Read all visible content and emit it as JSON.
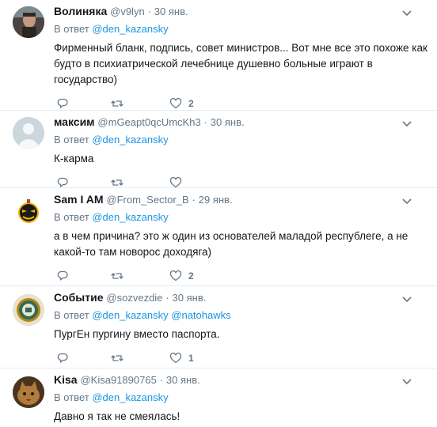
{
  "tweets": [
    {
      "name": "Волиняка",
      "handle": "@v9lyn",
      "dot": "·",
      "time": "30 янв.",
      "reply_prefix": "В ответ",
      "reply_links": [
        "@den_kazansky"
      ],
      "text": "Фирменный бланк, подпись, совет министров... Вот мне все это похоже как будто в психиатрической лечебнице душевно больные играют в государство)",
      "like_count": "2",
      "avatar": "photo-man-icon"
    },
    {
      "name": "максим",
      "handle": "@mGeapt0qcUmcKh3",
      "dot": "·",
      "time": "30 янв.",
      "reply_prefix": "В ответ",
      "reply_links": [
        "@den_kazansky"
      ],
      "text": "К-карма",
      "like_count": "",
      "avatar": "default-avatar-icon"
    },
    {
      "name": "Sam I AM",
      "handle": "@From_Sector_B",
      "dot": "·",
      "time": "29 янв.",
      "reply_prefix": "В ответ",
      "reply_links": [
        "@den_kazansky"
      ],
      "text": "а в чем причина? это ж один из основателей маладой республеге, а не какой-то там новорос доходяга)",
      "like_count": "2",
      "avatar": "serious-sam-bomb-icon"
    },
    {
      "name": "Событие",
      "handle": "@sozvezdie",
      "dot": "·",
      "time": "30 янв.",
      "reply_prefix": "В ответ",
      "reply_links": [
        "@den_kazansky",
        "@natohawks"
      ],
      "text": "ПургЕн пургину вместо паспорта.",
      "like_count": "1",
      "avatar": "badge-logo-icon"
    },
    {
      "name": "Kisa",
      "handle": "@Kisa91890765",
      "dot": "·",
      "time": "30 янв.",
      "reply_prefix": "В ответ",
      "reply_links": [
        "@den_kazansky"
      ],
      "text": "Давно я так не смеялась!",
      "like_count": "",
      "avatar": "cat-photo-icon"
    }
  ],
  "colors": {
    "text": "#14171a",
    "muted": "#657786",
    "link": "#1b95e0",
    "divider": "#e6ecf0"
  }
}
